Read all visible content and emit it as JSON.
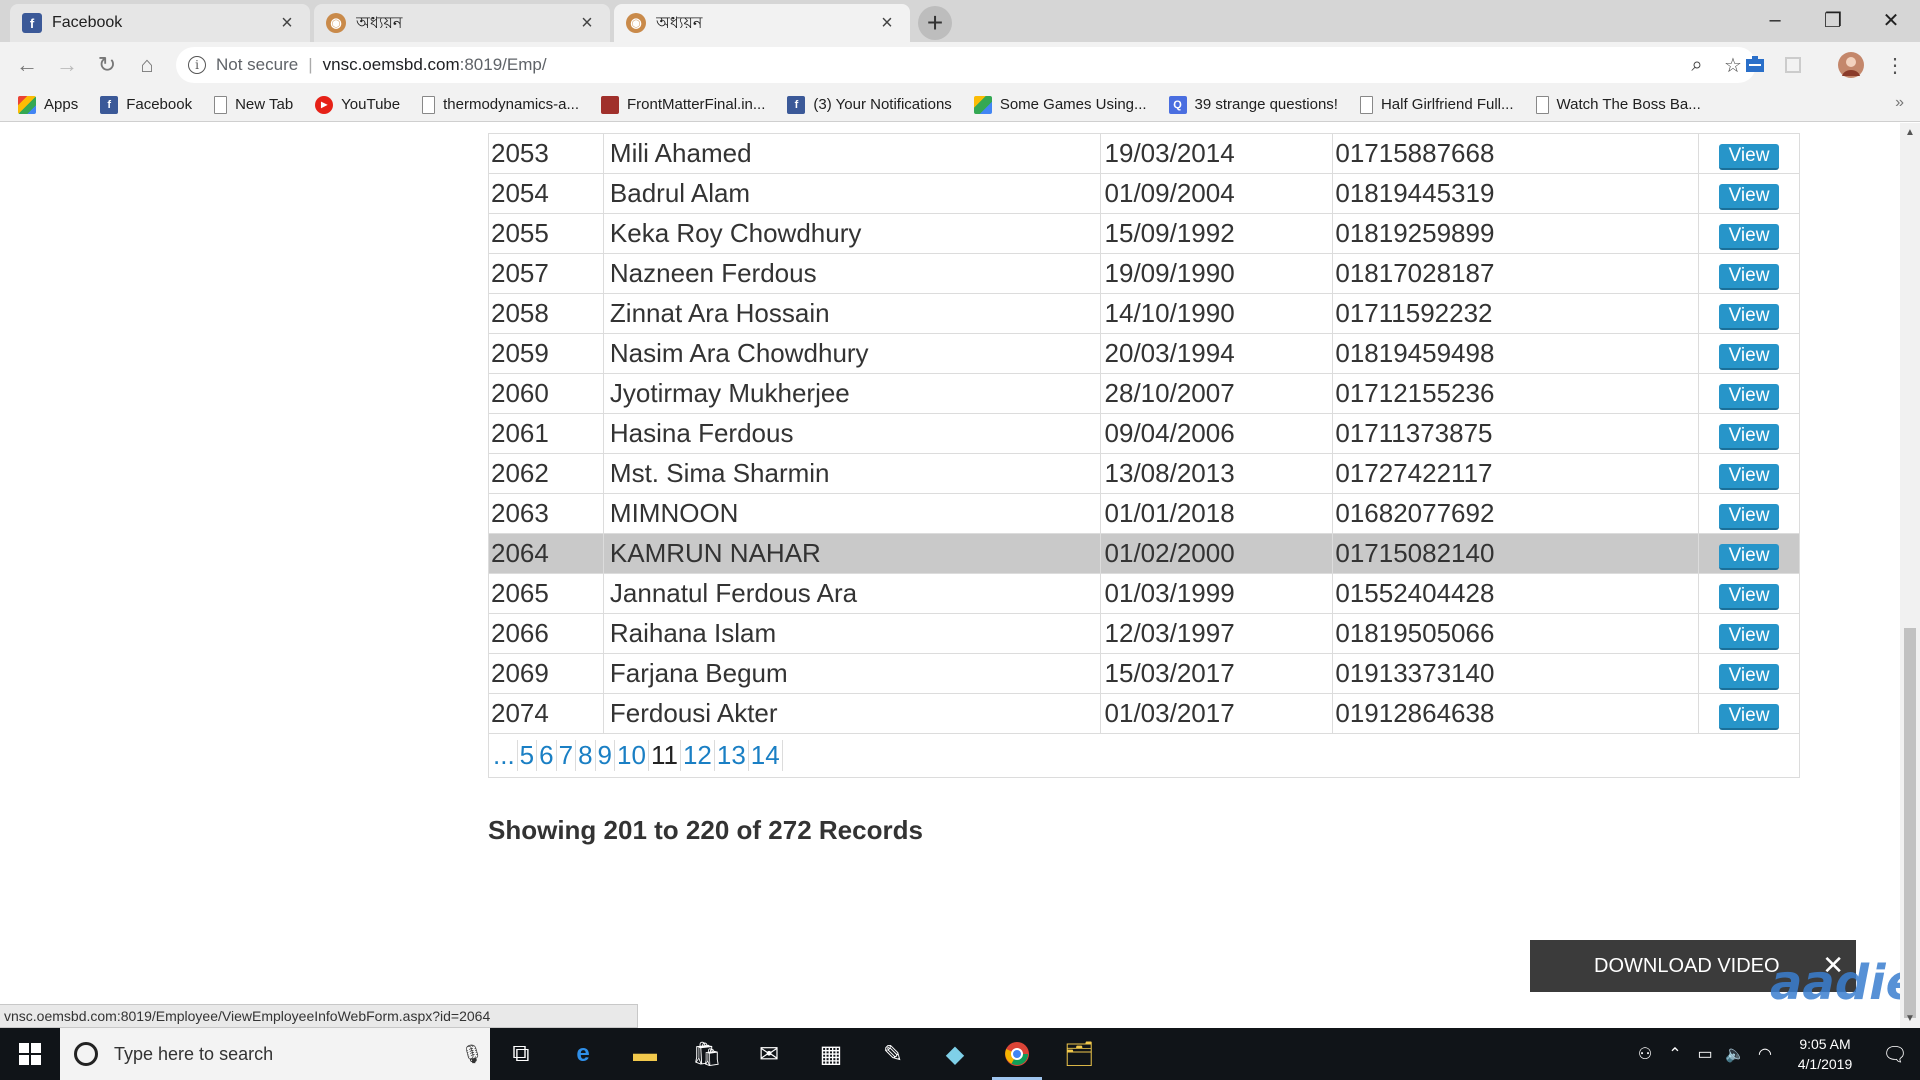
{
  "browser": {
    "tabs": [
      {
        "title": "Facebook",
        "icon": "facebook-icon"
      },
      {
        "title": "অধ্যয়ন",
        "icon": "owl-icon"
      },
      {
        "title": "অধ্যয়ন",
        "icon": "owl-icon"
      }
    ],
    "new_tab_label": "+",
    "window_controls": {
      "minimize": "–",
      "maximize": "❐",
      "close": "✕"
    },
    "address": {
      "security_label": "Not secure",
      "host": "vnsc.oemsbd.com",
      "path": ":8019/Emp/"
    },
    "bookmarks": [
      {
        "label": "Apps",
        "icon": "apps"
      },
      {
        "label": "Facebook",
        "icon": "fb"
      },
      {
        "label": "New Tab",
        "icon": "page"
      },
      {
        "label": "YouTube",
        "icon": "yt"
      },
      {
        "label": "thermodynamics-a...",
        "icon": "page"
      },
      {
        "label": "FrontMatterFinal.in...",
        "icon": "fm"
      },
      {
        "label": "(3) Your Notifications",
        "icon": "fb"
      },
      {
        "label": "Some Games Using...",
        "icon": "drive"
      },
      {
        "label": "39 strange questions!",
        "icon": "q"
      },
      {
        "label": "Half Girlfriend Full...",
        "icon": "page"
      },
      {
        "label": "Watch The Boss Ba...",
        "icon": "page"
      }
    ],
    "bookmarks_more": "»",
    "status_url": "vnsc.oemsbd.com:8019/Employee/ViewEmployeeInfoWebForm.aspx?id=2064"
  },
  "grid": {
    "view_label": "View",
    "rows": [
      {
        "id": "2053",
        "name": "Mili Ahamed",
        "date": "19/03/2014",
        "phone": "01715887668"
      },
      {
        "id": "2054",
        "name": "Badrul Alam",
        "date": "01/09/2004",
        "phone": "01819445319"
      },
      {
        "id": "2055",
        "name": "Keka Roy Chowdhury",
        "date": "15/09/1992",
        "phone": "01819259899"
      },
      {
        "id": "2057",
        "name": "Nazneen Ferdous",
        "date": "19/09/1990",
        "phone": "01817028187"
      },
      {
        "id": "2058",
        "name": "Zinnat Ara Hossain",
        "date": "14/10/1990",
        "phone": "01711592232"
      },
      {
        "id": "2059",
        "name": "Nasim Ara Chowdhury",
        "date": "20/03/1994",
        "phone": "01819459498"
      },
      {
        "id": "2060",
        "name": "Jyotirmay Mukherjee",
        "date": "28/10/2007",
        "phone": "01712155236"
      },
      {
        "id": "2061",
        "name": "Hasina Ferdous",
        "date": "09/04/2006",
        "phone": "01711373875"
      },
      {
        "id": "2062",
        "name": "Mst. Sima Sharmin",
        "date": "13/08/2013",
        "phone": "01727422117"
      },
      {
        "id": "2063",
        "name": "MIMNOON",
        "date": "01/01/2018",
        "phone": "01682077692"
      },
      {
        "id": "2064",
        "name": "KAMRUN NAHAR",
        "date": "01/02/2000",
        "phone": "01715082140",
        "highlighted": true
      },
      {
        "id": "2065",
        "name": "Jannatul Ferdous Ara",
        "date": "01/03/1999",
        "phone": "01552404428"
      },
      {
        "id": "2066",
        "name": "Raihana Islam",
        "date": "12/03/1997",
        "phone": "01819505066"
      },
      {
        "id": "2069",
        "name": "Farjana Begum",
        "date": "15/03/2017",
        "phone": "01913373140"
      },
      {
        "id": "2074",
        "name": "Ferdousi Akter",
        "date": "01/03/2017",
        "phone": "01912864638"
      }
    ],
    "pager": [
      "...",
      "5",
      "6",
      "7",
      "8",
      "9",
      "10",
      "11",
      "12",
      "13",
      "14"
    ],
    "current_page": "11"
  },
  "summary": "Showing 201 to 220 of 272 Records",
  "overlay": {
    "download_label": "DOWNLOAD VIDEO",
    "close": "✕",
    "watermark": "aadie"
  },
  "taskbar": {
    "search_placeholder": "Type here to search",
    "time": "9:05 AM",
    "date": "4/1/2019"
  },
  "colors": {
    "link": "#1a7fc4",
    "view_button": "#2795c9",
    "highlight_row": "#c9c9c9"
  }
}
